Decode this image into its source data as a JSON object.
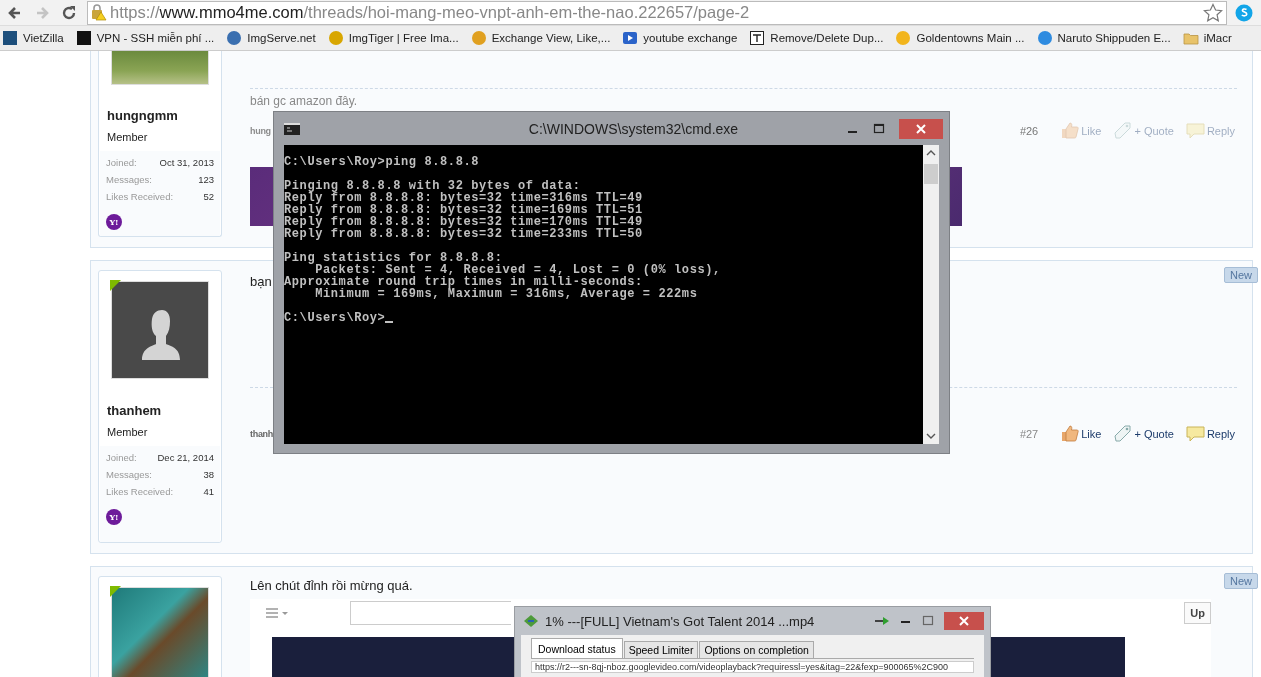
{
  "browser": {
    "nav": [
      {
        "kind": "back",
        "disabled": false
      },
      {
        "kind": "forward",
        "disabled": true
      },
      {
        "kind": "reload",
        "disabled": false
      }
    ],
    "url": {
      "scheme": "https://",
      "host": "www.mmo4me.com",
      "path": "/threads/hoi-mang-meo-vnpt-anh-em-the-nao.222657/page-2"
    },
    "bookmarks": [
      {
        "label": "VietZilla",
        "kind": "square",
        "color": "#1d4f7c"
      },
      {
        "label": "VPN - SSH miễn phí ...",
        "kind": "square",
        "color": "#111111"
      },
      {
        "label": "ImgServe.net",
        "kind": "circle",
        "color": "#3a6fb0"
      },
      {
        "label": "ImgTiger | Free Ima...",
        "kind": "circle",
        "color": "#d8a600"
      },
      {
        "label": "Exchange View, Like,...",
        "kind": "circle",
        "color": "#e0a020"
      },
      {
        "label": "youtube exchange",
        "kind": "play",
        "color": "#2a63c9"
      },
      {
        "label": "Remove/Delete Dup...",
        "kind": "doc",
        "color": "#222222"
      },
      {
        "label": "Goldentowns Main ...",
        "kind": "circle",
        "color": "#f2b51c"
      },
      {
        "label": "Naruto Shippuden E...",
        "kind": "circle",
        "color": "#2e8be0"
      },
      {
        "label": "iMacr",
        "kind": "folder",
        "color": "#e8c36a"
      }
    ]
  },
  "posts": [
    {
      "avatar": {
        "kind": "photo"
      },
      "username": "hungngmm",
      "title": "Member",
      "stats": [
        {
          "label": "Joined:",
          "value": "Oct 31, 2013"
        },
        {
          "label": "Messages:",
          "value": "123"
        },
        {
          "label": "Likes Received:",
          "value": "52"
        }
      ],
      "contact_badge": "Y!",
      "signature": "bán gc amazon đây.",
      "author": "hung",
      "number": "#26",
      "actions_faded": true,
      "actions": [
        {
          "kind": "like",
          "label": "Like"
        },
        {
          "kind": "quote",
          "label": "+ Quote"
        },
        {
          "kind": "reply",
          "label": "Reply"
        }
      ],
      "banner": true
    },
    {
      "avatar": {
        "kind": "silhouette"
      },
      "online": true,
      "username": "thanhem",
      "title": "Member",
      "stats": [
        {
          "label": "Joined:",
          "value": "Dec 21, 2014"
        },
        {
          "label": "Messages:",
          "value": "38"
        },
        {
          "label": "Likes Received:",
          "value": "41"
        }
      ],
      "contact_badge": "Y!",
      "new": true,
      "new_label": "New",
      "message": "bạn",
      "author": "thanh",
      "number": "#27",
      "actions_faded": false,
      "actions": [
        {
          "kind": "like",
          "label": "Like"
        },
        {
          "kind": "quote",
          "label": "+ Quote"
        },
        {
          "kind": "reply",
          "label": "Reply"
        }
      ]
    },
    {
      "avatar": {
        "kind": "artwork"
      },
      "online": true,
      "new": true,
      "new_label": "New",
      "message": "Lên chút đỉnh rồi mừng quá.",
      "embed": {
        "button": "Up"
      }
    }
  ],
  "cmd_window": {
    "title": "C:\\WINDOWS\\system32\\cmd.exe",
    "blocks": [
      [
        "C:\\Users\\Roy>ping 8.8.8.8"
      ],
      [
        "Pinging 8.8.8.8 with 32 bytes of data:",
        "Reply from 8.8.8.8: bytes=32 time=316ms TTL=49",
        "Reply from 8.8.8.8: bytes=32 time=169ms TTL=51",
        "Reply from 8.8.8.8: bytes=32 time=170ms TTL=49",
        "Reply from 8.8.8.8: bytes=32 time=233ms TTL=50"
      ],
      [
        "Ping statistics for 8.8.8.8:",
        "    Packets: Sent = 4, Received = 4, Lost = 0 (0% loss),",
        "Approximate round trip times in milli-seconds:",
        "    Minimum = 169ms, Maximum = 316ms, Average = 222ms"
      ],
      [
        "C:\\Users\\Roy>"
      ]
    ],
    "cursor": true
  },
  "download_window": {
    "title": "1% ---[FULL] Vietnam's Got Talent 2014 ...mp4",
    "tabs": [
      {
        "label": "Download status",
        "selected": true
      },
      {
        "label": "Speed Limiter",
        "selected": false
      },
      {
        "label": "Options on completion",
        "selected": false
      }
    ],
    "url": "https://r2---sn-8qj-nboz.googlevideo.com/videoplayback?requiressl=yes&itag=22&fexp=900065%2C900"
  }
}
